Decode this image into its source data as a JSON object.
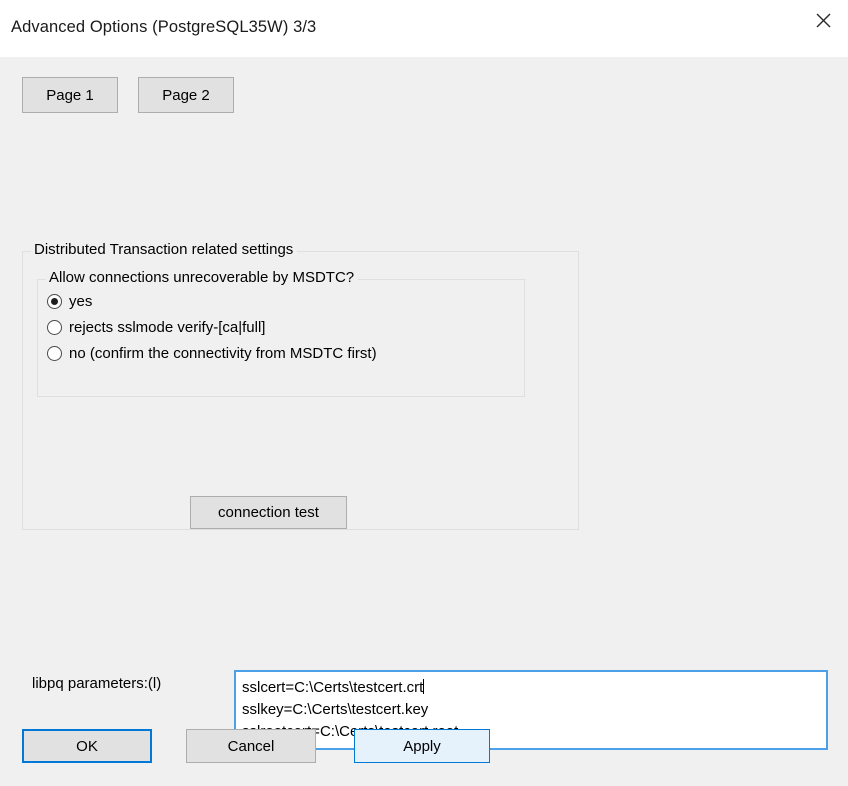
{
  "window": {
    "title": "Advanced Options (PostgreSQL35W) 3/3",
    "close_label": "Close"
  },
  "tabs": [
    {
      "label": "Page 1"
    },
    {
      "label": "Page 2"
    }
  ],
  "groups": {
    "outer": {
      "legend": "Distributed Transaction related settings"
    },
    "inner": {
      "legend": "Allow connections unrecoverable by MSDTC?",
      "options": [
        {
          "label": "yes",
          "checked": true
        },
        {
          "label": "rejects sslmode verify-[ca|full]",
          "checked": false
        },
        {
          "label": "no (confirm the connectivity from MSDTC first)",
          "checked": false
        }
      ]
    },
    "connection_test": {
      "label": "connection test"
    }
  },
  "libpq": {
    "label": "libpq parameters:(l)",
    "lines": [
      "sslcert=C:\\Certs\\testcert.crt",
      "sslkey=C:\\Certs\\testcert.key",
      "sslrootcert=C:\\Certs\\testcert.root"
    ]
  },
  "footer": {
    "ok": "OK",
    "cancel": "Cancel",
    "apply": "Apply"
  },
  "colors": {
    "accent": "#0078d7",
    "focus_border": "#4ba0e8",
    "button_face": "#e1e1e1",
    "button_border": "#adadad",
    "dialog_bg": "#f0f0f0",
    "titlebar_bg": "#ffffff",
    "apply_fill": "#e5f1fb",
    "group_border": "#dfdfdf"
  }
}
